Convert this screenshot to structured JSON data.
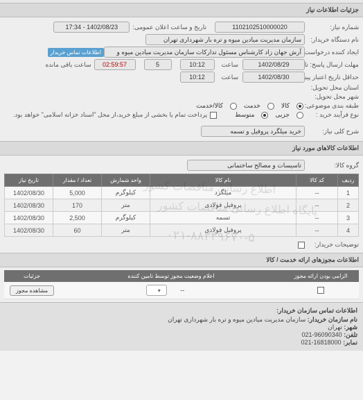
{
  "section_titles": {
    "need_details": "جزئیات اطلاعات نیاز",
    "need_items": "اطلاعات کالاهای مورد نیاز",
    "permits": "اطلاعات مجوزهای ارائه خدمت / کالا",
    "contact": "اطلاعات تماس سازمان خریدار:"
  },
  "labels": {
    "need_no": "شماره نیاز:",
    "announce_dt": "تاریخ و ساعت اعلان عمومی:",
    "buyer_org": "نام دستگاه خریدار:",
    "requester": "ایجاد کننده درخواست:",
    "answer_deadline": "مهلت ارسال پاسخ: تا تاریخ:",
    "time": "ساعت",
    "remaining": "ساعت باقی مانده",
    "credit_deadline": "حداقل تاریخ اعتبار پیشنهاد: تا تاریخ:",
    "delivery_prov": "استان محل تحویل:",
    "delivery_city": "شهر محل تحویل:",
    "budget_class": "طبقه بندی موضوعی:",
    "payment_type": "نوع فرآیند خرید :",
    "payment_desc": "پرداخت تمام یا بخشی از مبلغ خرید،از محل \"اسناد خزانه اسلامی\" خواهد بود.",
    "need_title": "شرح کلی نیاز:",
    "goods_group": "گروه کالا:",
    "buyer_notes": "توضیحات خریدار:",
    "contact_link": "اطلاعات تماس خریدار"
  },
  "fields": {
    "need_no": "1102102510000020",
    "announce_dt": "1402/08/23 - 17:34",
    "buyer_org": "سازمان مدیریت میادین میوه و تره بار شهرداری تهران",
    "requester": "آرش جهان زاد کارشناس مسئول تدارکات سازمان مدیریت میادین میوه و تره بار ت",
    "ans_date": "1402/08/29",
    "ans_time": "10:12",
    "ans_days": "5",
    "ans_remaining": "02:59:57",
    "credit_date": "1402/08/30",
    "credit_time": "10:12",
    "need_title": "خرید میلگرد پروفیل و تسمه",
    "goods_group": "تاسیسات و مصالح ساختمانی"
  },
  "budget_options": {
    "opt_goods": "کالا",
    "opt_service": "خدمت",
    "opt_goods_service": "کالا/خدمت",
    "selected": "opt_goods"
  },
  "payment_options": {
    "opt_small": "جزیی",
    "opt_medium": "متوسط",
    "selected": "opt_medium"
  },
  "items_table": {
    "headers": {
      "row": "ردیف",
      "code": "کد کالا",
      "name": "نام کالا",
      "unit": "واحد شمارش",
      "qty": "تعداد / مقدار",
      "date": "تاریخ نیاز"
    },
    "rows": [
      {
        "row": "1",
        "code": "--",
        "name": "میلگرد",
        "unit": "کیلوگرم",
        "qty": "5,000",
        "date": "1402/08/30"
      },
      {
        "row": "2",
        "code": "--",
        "name": "پروفیل فولادی",
        "unit": "متر",
        "qty": "170",
        "date": "1402/08/30"
      },
      {
        "row": "3",
        "code": "--",
        "name": "تسمه",
        "unit": "کیلوگرم",
        "qty": "2,500",
        "date": "1402/08/30"
      },
      {
        "row": "4",
        "code": "--",
        "name": "پروفیل فولادی",
        "unit": "متر",
        "qty": "60",
        "date": "1402/08/30"
      }
    ],
    "watermark1": "اطلاع رسانی مناقصات کشور",
    "watermark2": "پایگاه اطلاع رسانی مناقصات کشور",
    "watermark_phone": "۰۲۱-۸۸۳۴۹۶۷۰-۵"
  },
  "permits_table": {
    "headers": {
      "mandatory": "الزامی بودن ارائه مجوز",
      "status": "اعلام وضعیت مجوز توسط تامین کننده",
      "details": "جزئیات"
    },
    "row": {
      "status_val": "--",
      "details_btn": "مشاهده مجوز"
    }
  },
  "contact": {
    "org_label": "نام سازمان خریدار:",
    "org_val": "سازمان مدیریت میادین میوه و تره بار شهرداری تهران",
    "prov_label": "شهر:",
    "prov_val": "تهران",
    "tel_label": "تلفن:",
    "tel_val": "96090340-021",
    "fax_label": "نمابر:",
    "fax_val": "16818000-021"
  }
}
